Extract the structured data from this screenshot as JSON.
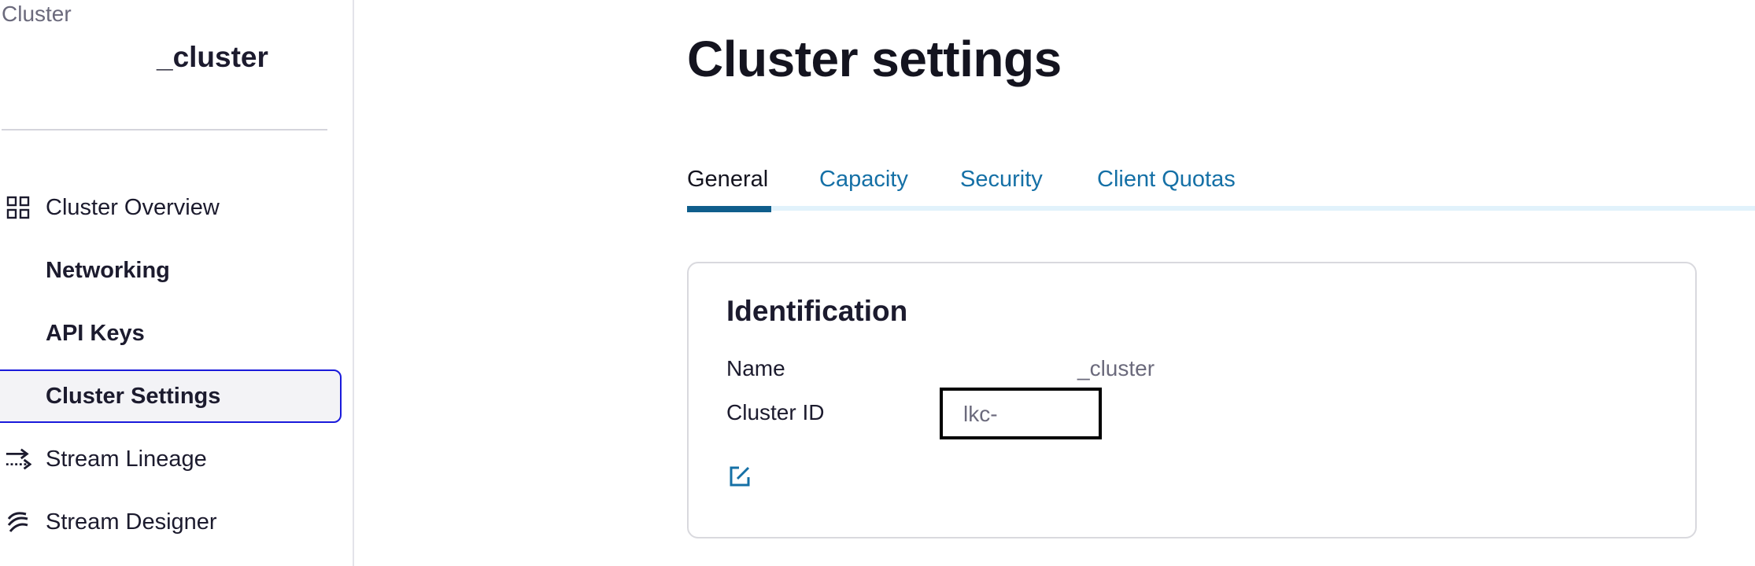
{
  "sidebar": {
    "breadcrumb": "Cluster",
    "cluster_name": "_cluster",
    "items": [
      {
        "label": "Cluster Overview",
        "icon": "grid-icon"
      },
      {
        "label": "Networking",
        "icon": ""
      },
      {
        "label": "API Keys",
        "icon": ""
      },
      {
        "label": "Cluster Settings",
        "icon": "",
        "active": true
      },
      {
        "label": "Stream Lineage",
        "icon": "stream-lineage-icon"
      },
      {
        "label": "Stream Designer",
        "icon": "stream-designer-icon"
      }
    ]
  },
  "main": {
    "title": "Cluster settings",
    "tabs": [
      {
        "label": "General",
        "active": true
      },
      {
        "label": "Capacity"
      },
      {
        "label": "Security"
      },
      {
        "label": "Client Quotas"
      }
    ],
    "card": {
      "title": "Identification",
      "fields": [
        {
          "label": "Name",
          "value": "_cluster"
        },
        {
          "label": "Cluster ID",
          "value": "lkc-"
        }
      ],
      "edit_icon": "edit-icon"
    }
  },
  "colors": {
    "accent": "#1570a6",
    "active_border": "#1a1adb",
    "tab_underline": "#0f5e8c",
    "tab_track": "#e1f2fb"
  }
}
